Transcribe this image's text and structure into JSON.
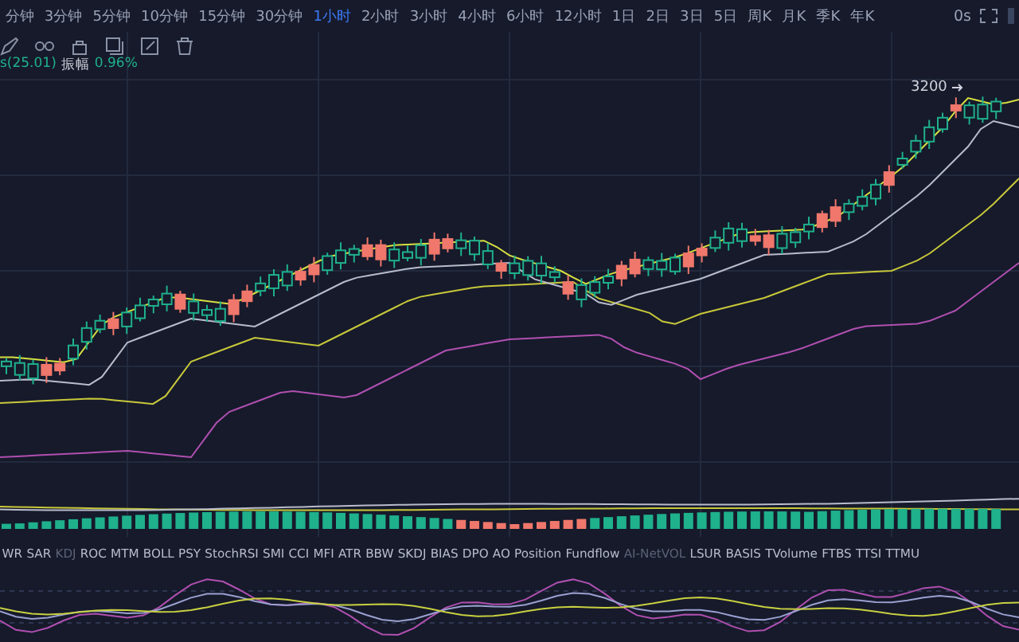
{
  "timeframes": [
    {
      "label": "分钟",
      "selected": false
    },
    {
      "label": "3分钟",
      "selected": false
    },
    {
      "label": "5分钟",
      "selected": false
    },
    {
      "label": "10分钟",
      "selected": false
    },
    {
      "label": "15分钟",
      "selected": false
    },
    {
      "label": "30分钟",
      "selected": false
    },
    {
      "label": "1小时",
      "selected": true
    },
    {
      "label": "2小时",
      "selected": false
    },
    {
      "label": "3小时",
      "selected": false
    },
    {
      "label": "4小时",
      "selected": false
    },
    {
      "label": "6小时",
      "selected": false
    },
    {
      "label": "12小时",
      "selected": false
    },
    {
      "label": "1日",
      "selected": false
    },
    {
      "label": "2日",
      "selected": false
    },
    {
      "label": "3日",
      "selected": false
    },
    {
      "label": "5日",
      "selected": false
    },
    {
      "label": "周K",
      "selected": false
    },
    {
      "label": "月K",
      "selected": false
    },
    {
      "label": "季K",
      "selected": false
    },
    {
      "label": "年K",
      "selected": false
    }
  ],
  "status": "0s",
  "info": {
    "value": "s(25.01)",
    "label": "振幅",
    "amplitude": "0.96%"
  },
  "price_marker": "3200",
  "indicators": [
    {
      "label": "WR",
      "selected": false
    },
    {
      "label": "SAR",
      "selected": false
    },
    {
      "label": "KDJ",
      "selected": true
    },
    {
      "label": "ROC",
      "selected": false
    },
    {
      "label": "MTM",
      "selected": false
    },
    {
      "label": "BOLL",
      "selected": false
    },
    {
      "label": "PSY",
      "selected": false
    },
    {
      "label": "StochRSI",
      "selected": false
    },
    {
      "label": "SMI",
      "selected": false
    },
    {
      "label": "CCI",
      "selected": false
    },
    {
      "label": "MFI",
      "selected": false
    },
    {
      "label": "ATR",
      "selected": false
    },
    {
      "label": "BBW",
      "selected": false
    },
    {
      "label": "SKDJ",
      "selected": false
    },
    {
      "label": "BIAS",
      "selected": false
    },
    {
      "label": "DPO",
      "selected": false
    },
    {
      "label": "AO",
      "selected": false
    },
    {
      "label": "Position",
      "selected": false
    },
    {
      "label": "Fundflow",
      "selected": false
    },
    {
      "label": "AI-NetVOL",
      "selected": true
    },
    {
      "label": "LSUR",
      "selected": false
    },
    {
      "label": "BASIS",
      "selected": false
    },
    {
      "label": "TVolume",
      "selected": false
    },
    {
      "label": "FTBS",
      "selected": false
    },
    {
      "label": "TTSI",
      "selected": false
    },
    {
      "label": "TTMU",
      "selected": false
    }
  ]
}
